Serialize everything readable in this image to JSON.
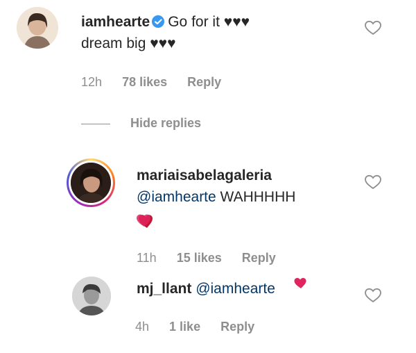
{
  "comments": [
    {
      "username": "iamhearte",
      "text": "Go for it ♥♥♥",
      "text_line2": "dream big ♥♥♥",
      "time": "12h",
      "likes": "78 likes",
      "reply": "Reply",
      "verified": true
    },
    {
      "username": "mariaisabelagaleria",
      "mention": "@iamhearte",
      "text": "WAHHHHH",
      "time": "11h",
      "likes": "15 likes",
      "reply": "Reply"
    },
    {
      "username": "mj_llant",
      "mention": "@iamhearte",
      "time": "4h",
      "likes": "1 like",
      "reply": "Reply"
    }
  ],
  "hide_replies": "Hide replies",
  "colors": {
    "text": "#262626",
    "meta": "#8e8e8e",
    "mention": "#00376b",
    "verified": "#3897f0",
    "heart": "#e0245e"
  },
  "icons": [
    "heart-outline-icon",
    "verified-badge-icon",
    "heart-emoji-icon"
  ]
}
